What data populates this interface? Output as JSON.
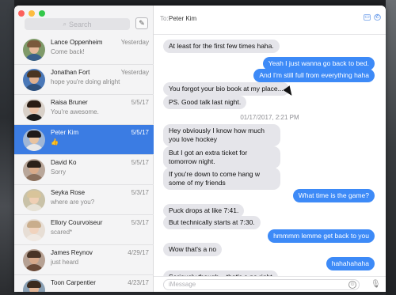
{
  "window": {
    "traffic_light_colors": [
      "#fc605c",
      "#fdbc40",
      "#34c84a"
    ]
  },
  "sidebar": {
    "search_placeholder": "Search",
    "search_icon": "search-icon",
    "compose_icon": "compose-icon",
    "conversations": [
      {
        "name": "Lance Oppenheim",
        "date": "Yesterday",
        "snippet": "Come back!",
        "avatar": {
          "bg": "#7f9a6a",
          "skin": "#e6b99a",
          "hair": "#7a5a3c",
          "shirt": "#3a5f8a"
        }
      },
      {
        "name": "Jonathan Fort",
        "date": "Yesterday",
        "snippet": "hope you're doing alright",
        "avatar": {
          "bg": "#4a78b8",
          "skin": "#e0b08f",
          "hair": "#4b3522",
          "shirt": "#2f4f7a"
        }
      },
      {
        "name": "Raisa Bruner",
        "date": "5/5/17",
        "snippet": "You're awesome.",
        "avatar": {
          "bg": "#d8d0c8",
          "skin": "#eac1a6",
          "hair": "#2a1c14",
          "shirt": "#1b1b1b"
        }
      },
      {
        "name": "Peter Kim",
        "date": "5/5/17",
        "snippet": "👍",
        "avatar": {
          "bg": "#9fb6d6",
          "skin": "#e8c3a0",
          "hair": "#1f1a18",
          "shirt": "#e8e8e8"
        }
      },
      {
        "name": "David Ko",
        "date": "5/5/17",
        "snippet": "Sorry",
        "avatar": {
          "bg": "#b9a79a",
          "skin": "#d9ab8a",
          "hair": "#2b2018",
          "shirt": "#8a6f5c"
        }
      },
      {
        "name": "Seyka Rose",
        "date": "5/3/17",
        "snippet": "where are you?",
        "avatar": {
          "bg": "#c9c2a8",
          "skin": "#efcfb4",
          "hair": "#d8c49a",
          "shirt": "#e7e2d6"
        }
      },
      {
        "name": "Ellory Courvoiseur",
        "date": "5/3/17",
        "snippet": "scared*",
        "avatar": {
          "bg": "#e7ded5",
          "skin": "#f1d3bd",
          "hair": "#c9ad8c",
          "shirt": "#f0e9e2"
        }
      },
      {
        "name": "James Reynov",
        "date": "4/29/17",
        "snippet": "just heard",
        "avatar": {
          "bg": "#b6a193",
          "skin": "#d7a98b",
          "hair": "#4a3426",
          "shirt": "#6a4a38"
        }
      },
      {
        "name": "Toon Carpentier",
        "date": "4/23/17",
        "snippet": "",
        "avatar": {
          "bg": "#8aa0b4",
          "skin": "#e1b596",
          "hair": "#3a2a1e",
          "shirt": "#2f3f55"
        }
      }
    ]
  },
  "chat": {
    "to_label": "To:",
    "recipient": "Peter Kim",
    "header_icons": [
      "video-icon",
      "phone-icon"
    ],
    "messages": [
      {
        "dir": "in",
        "text": "At least for the first few times haha."
      },
      {
        "dir": "out",
        "text": "Yeah I just wanna go back to bed."
      },
      {
        "dir": "out",
        "text": "And I'm still full from everything haha"
      },
      {
        "dir": "in",
        "text": "You forgot your bio book at my place..."
      },
      {
        "dir": "in",
        "text": "PS. Good talk last night."
      },
      {
        "dir": "ts",
        "text": "01/17/2017, 2:21 PM"
      },
      {
        "dir": "in",
        "text": "Hey obviously I know how much you love hockey"
      },
      {
        "dir": "in",
        "text": "But I got an extra ticket for tomorrow night."
      },
      {
        "dir": "in",
        "text": "If you're down to come hang w some of my friends"
      },
      {
        "dir": "out",
        "text": "What time is the game?"
      },
      {
        "dir": "in",
        "text": "Puck drops at like 7:41."
      },
      {
        "dir": "in",
        "text": "But technically starts at 7:30."
      },
      {
        "dir": "out",
        "text": "hmmmm lemme get back to you"
      },
      {
        "dir": "in",
        "text": "Wow that's a no"
      },
      {
        "dir": "out",
        "text": "hahahahaha"
      },
      {
        "dir": "in",
        "text": "Seriously though... that's a no right"
      }
    ],
    "input_placeholder": "iMessage",
    "emoji_icon": "emoji-icon",
    "mic_icon": "microphone-icon"
  }
}
